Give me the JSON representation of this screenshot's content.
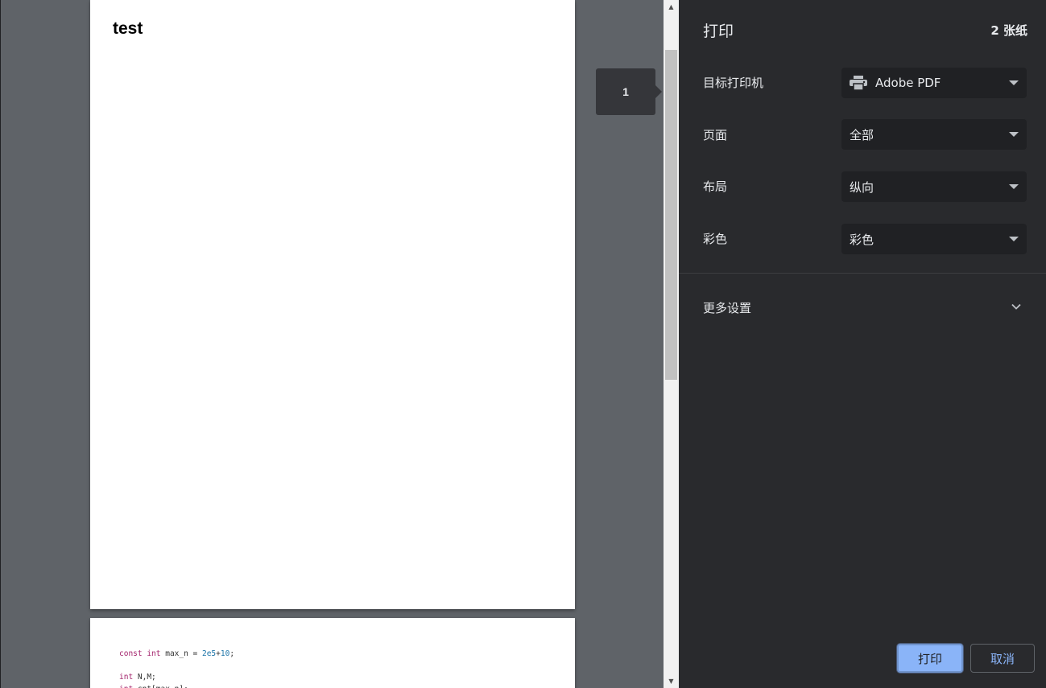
{
  "preview": {
    "page1_title": "test",
    "page_indicator": "1",
    "code_lines": [
      [
        {
          "t": "const ",
          "c": "kw"
        },
        {
          "t": "int ",
          "c": "kw"
        },
        {
          "t": "max_n = ",
          "c": ""
        },
        {
          "t": "2e5",
          "c": "num"
        },
        {
          "t": "+",
          "c": ""
        },
        {
          "t": "10",
          "c": "num"
        },
        {
          "t": ";",
          "c": ""
        }
      ],
      [],
      [
        {
          "t": "int ",
          "c": "kw"
        },
        {
          "t": "N,M;",
          "c": ""
        }
      ],
      [
        {
          "t": "int ",
          "c": "kw"
        },
        {
          "t": "cnt[max_n];",
          "c": ""
        }
      ]
    ]
  },
  "sidebar": {
    "title": "打印",
    "sheet_count": "2 张纸",
    "settings": [
      {
        "label": "目标打印机",
        "value": "Adobe PDF",
        "icon": "printer-icon"
      },
      {
        "label": "页面",
        "value": "全部"
      },
      {
        "label": "布局",
        "value": "纵向"
      },
      {
        "label": "彩色",
        "value": "彩色"
      }
    ],
    "more_settings": "更多设置",
    "print_button": "打印",
    "cancel_button": "取消"
  },
  "colors": {
    "sidebar_bg": "#292a2d",
    "select_bg": "#202124",
    "preview_bg": "#5f6368",
    "primary_button": "#8ab4f8",
    "code_keyword": "#a3226b",
    "code_number": "#1a73a8"
  }
}
